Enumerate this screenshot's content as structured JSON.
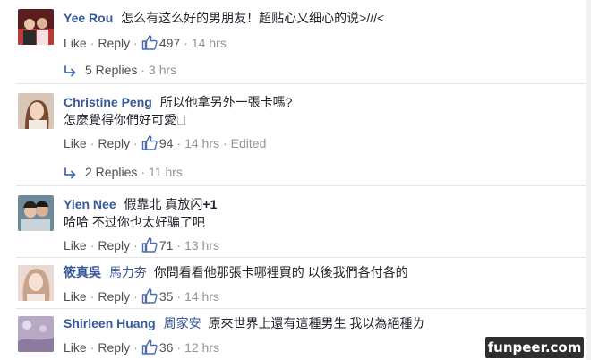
{
  "actions": {
    "like": "Like",
    "reply": "Reply",
    "separator": "·"
  },
  "comments": [
    {
      "author": "Yee Rou",
      "mention": "",
      "text_html": "怎么有这么好的男朋友！超贴心又细心的说>///<",
      "text2": "",
      "likes": "497",
      "time": "14 hrs",
      "edited": "",
      "replies": "5 Replies",
      "replies_time": "3 hrs"
    },
    {
      "author": "Christine Peng",
      "mention": "",
      "text_html": "所以他拿另外一張卡嗎?",
      "text2": "怎麼覺得你們好可愛",
      "likes": "94",
      "time": "14 hrs",
      "edited": "Edited",
      "replies": "2 Replies",
      "replies_time": "11 hrs"
    },
    {
      "author": "Yien Nee",
      "mention": "",
      "text_html": "假靠北 真放闪+1",
      "text2": "哈哈 不过你也太好骗了吧",
      "likes": "71",
      "time": "13 hrs",
      "edited": "",
      "replies": "",
      "replies_time": ""
    },
    {
      "author": "筱真吳",
      "mention": "馬力夯",
      "text_html": "你問看看他那張卡哪裡買的 以後我們各付各的",
      "text2": "",
      "likes": "35",
      "time": "14 hrs",
      "edited": "",
      "replies": "",
      "replies_time": ""
    },
    {
      "author": "Shirleen Huang",
      "mention": "周家安",
      "text_html": "原來世界上還有這種男生 我以為絕種ㄌ",
      "text2": "",
      "likes": "36",
      "time": "12 hrs",
      "edited": "",
      "replies": "",
      "replies_time": ""
    }
  ],
  "watermark": "funpeer.com",
  "colors": {
    "link": "#365899",
    "meta": "#90949c",
    "action": "#4b4f56",
    "divider": "#e5e6e9"
  }
}
